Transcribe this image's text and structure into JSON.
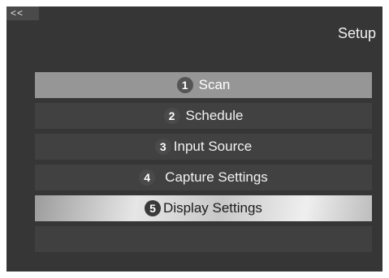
{
  "nav": {
    "back_label": "<<"
  },
  "header": {
    "title": "Setup"
  },
  "menu": {
    "items": [
      {
        "number": "1",
        "label": "Scan"
      },
      {
        "number": "2",
        "label": "Schedule"
      },
      {
        "number": "3",
        "label": "Input Source"
      },
      {
        "number": "4",
        "label": "Capture Settings"
      },
      {
        "number": "5",
        "label": "Display Settings"
      }
    ]
  },
  "colors": {
    "background": "#363636",
    "item": "#414141",
    "item_active": "#969696",
    "item_highlight": "#e6e6e6"
  }
}
